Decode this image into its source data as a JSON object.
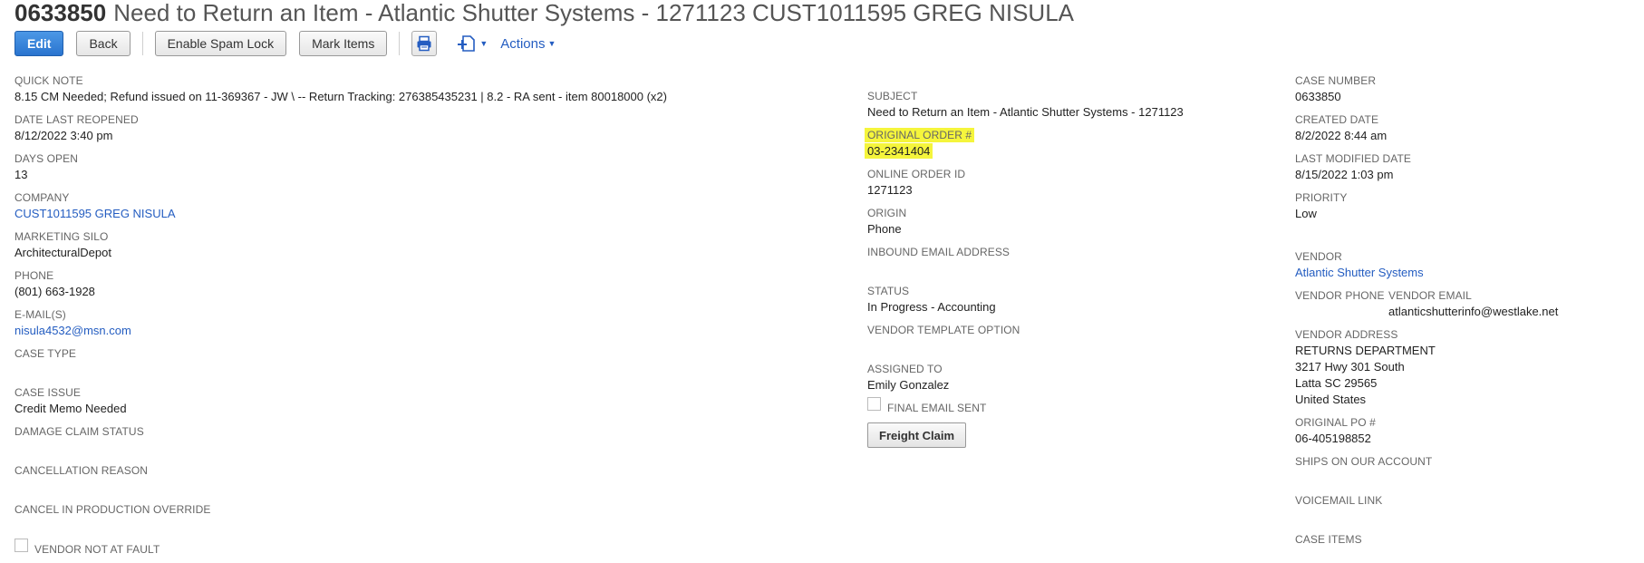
{
  "header": {
    "case_number": "0633850",
    "title": "Need to Return an Item - Atlantic Shutter Systems - 1271123 CUST1011595 GREG NISULA"
  },
  "toolbar": {
    "edit_label": "Edit",
    "back_label": "Back",
    "spam_lock_label": "Enable Spam Lock",
    "mark_items_label": "Mark Items",
    "actions_label": "Actions"
  },
  "left": {
    "quick_note_label": "QUICK NOTE",
    "quick_note_value": "8.15 CM Needed; Refund issued on 11-369367 - JW \\ -- Return Tracking: 276385435231 | 8.2 - RA sent - item 80018000 (x2)",
    "date_last_reopened_label": "DATE LAST REOPENED",
    "date_last_reopened_value": "8/12/2022 3:40 pm",
    "days_open_label": "DAYS OPEN",
    "days_open_value": "13",
    "company_label": "COMPANY",
    "company_value": "CUST1011595 GREG NISULA",
    "marketing_silo_label": "MARKETING SILO",
    "marketing_silo_value": "ArchitecturalDepot",
    "phone_label": "PHONE",
    "phone_value": "(801) 663-1928",
    "emails_label": "E-MAIL(S)",
    "emails_value": "nisula4532@msn.com",
    "case_type_label": "CASE TYPE",
    "case_issue_label": "CASE ISSUE",
    "case_issue_value": "Credit Memo Needed",
    "damage_claim_label": "DAMAGE CLAIM STATUS",
    "cancellation_label": "CANCELLATION REASON",
    "cancel_override_label": "CANCEL IN PRODUCTION OVERRIDE",
    "vendor_not_at_fault_label": "VENDOR NOT AT FAULT"
  },
  "middle": {
    "subject_label": "SUBJECT",
    "subject_value": "Need to Return an Item - Atlantic Shutter Systems - 1271123",
    "original_order_label": "ORIGINAL ORDER #",
    "original_order_value": "03-2341404",
    "online_order_label": "ONLINE ORDER ID",
    "online_order_value": "1271123",
    "origin_label": "ORIGIN",
    "origin_value": "Phone",
    "inbound_email_label": "INBOUND EMAIL ADDRESS",
    "status_label": "STATUS",
    "status_value": "In Progress - Accounting",
    "vendor_template_label": "VENDOR TEMPLATE OPTION",
    "assigned_to_label": "ASSIGNED TO",
    "assigned_to_value": "Emily Gonzalez",
    "final_email_label": "FINAL EMAIL SENT",
    "freight_claim_label": "Freight Claim"
  },
  "right": {
    "case_number_label": "CASE NUMBER",
    "case_number_value": "0633850",
    "created_date_label": "CREATED DATE",
    "created_date_value": "8/2/2022 8:44 am",
    "last_modified_label": "LAST MODIFIED DATE",
    "last_modified_value": "8/15/2022 1:03 pm",
    "priority_label": "PRIORITY",
    "priority_value": "Low",
    "vendor_label": "VENDOR",
    "vendor_value": "Atlantic Shutter Systems",
    "vendor_phone_label": "VENDOR PHONE",
    "vendor_email_label": "VENDOR EMAIL",
    "vendor_email_value": "atlanticshutterinfo@westlake.net",
    "vendor_address_label": "VENDOR ADDRESS",
    "vendor_address_line1": "RETURNS DEPARTMENT",
    "vendor_address_line2": "3217 Hwy 301 South",
    "vendor_address_line3": "Latta SC 29565",
    "vendor_address_line4": "United States",
    "original_po_label": "ORIGINAL PO #",
    "original_po_value": "06-405198852",
    "ships_on_account_label": "SHIPS ON OUR ACCOUNT",
    "voicemail_label": "VOICEMAIL LINK",
    "case_items_label": "CASE ITEMS"
  },
  "colors": {
    "link": "#245dc1",
    "primary_button": "#2a74cf",
    "highlight": "#f5f53c"
  },
  "icons": [
    "print-icon",
    "new-record-icon",
    "caret-down-icon"
  ]
}
